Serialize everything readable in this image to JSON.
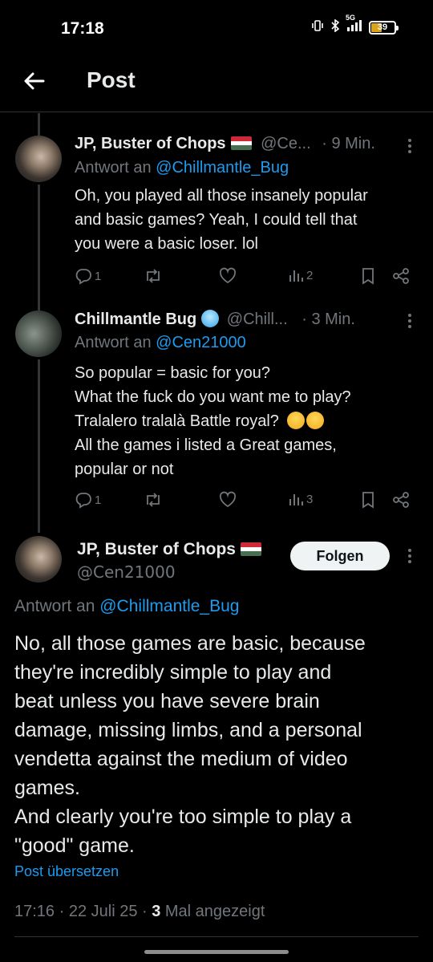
{
  "status_bar": {
    "time": "17:18",
    "network": "5G",
    "battery": "39"
  },
  "header": {
    "title": "Post"
  },
  "tweets": [
    {
      "name": "JP, Buster of Chops",
      "handle": "@Ce...",
      "time": "· 9 Min.",
      "reply_prefix": "Antwort an ",
      "reply_to": "@Chillmantle_Bug",
      "lines": [
        "Oh, you played all those insanely popular",
        "and basic games? Yeah, I could tell that",
        "you were a basic loser. lol"
      ],
      "replies": "1",
      "retweets": "",
      "likes": "",
      "views": "2"
    },
    {
      "name": "Chillmantle Bug",
      "handle": "@Chill...",
      "time": "· 3 Min.",
      "reply_prefix": "Antwort an ",
      "reply_to": "@Cen21000",
      "lines": [
        "So popular = basic for you?",
        "What the fuck do you want me to play?",
        "Tralalero tralalà Battle royal?",
        "All the games i listed a Great games,",
        "popular or not"
      ],
      "replies": "1",
      "retweets": "",
      "likes": "",
      "views": "3"
    }
  ],
  "main_post": {
    "name": "JP, Buster of Chops",
    "handle": "@Cen21000",
    "follow_label": "Folgen",
    "reply_prefix": "Antwort an ",
    "reply_to": "@Chillmantle_Bug",
    "lines": [
      "No, all those games are basic, because",
      "they're incredibly simple to play and",
      "beat unless you have severe brain",
      "damage, missing limbs, and a personal",
      "vendetta against the medium of video",
      "games.",
      "And clearly you're too simple to play a",
      "\"good\" game."
    ],
    "translate": "Post übersetzen",
    "timestamp": "17:16 · 22 Juli 25 · ",
    "views_count": "3",
    "views_label": " Mal angezeigt"
  },
  "colors": {
    "link": "#1d9bf0",
    "muted": "#71767b",
    "text": "#e7e9ea",
    "background": "#000000"
  }
}
